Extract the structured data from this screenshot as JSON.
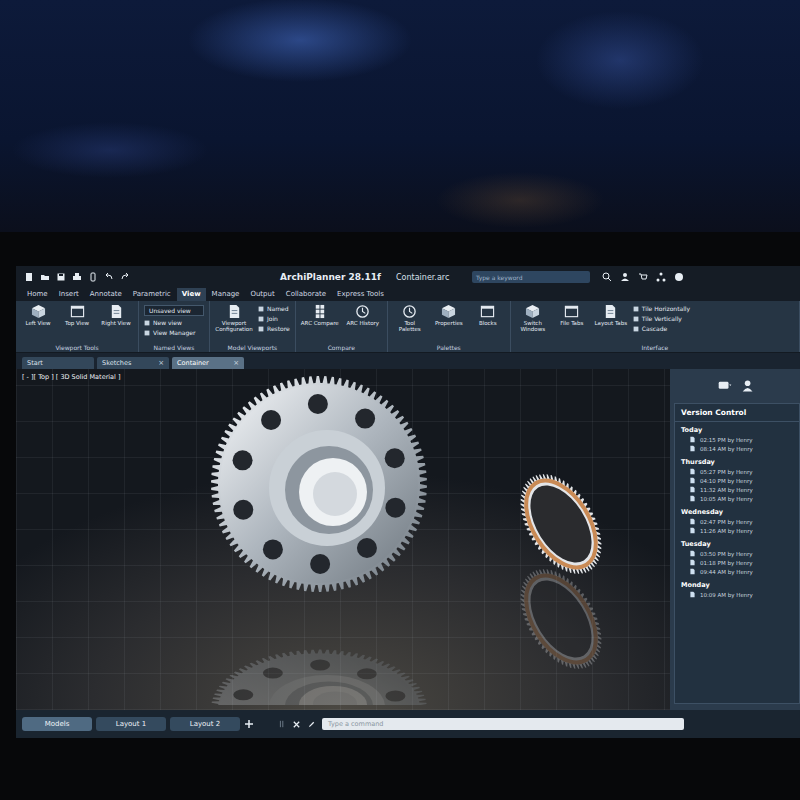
{
  "window": {
    "title": "ArchiPlanner 28.11f",
    "file": "Container.arc",
    "search": {
      "placeholder": "Type a keyword"
    }
  },
  "ribbon_tabs": [
    {
      "label": "Home",
      "selected": false
    },
    {
      "label": "Insert",
      "selected": false
    },
    {
      "label": "Annotate",
      "selected": false
    },
    {
      "label": "Parametric",
      "selected": false
    },
    {
      "label": "View",
      "selected": true
    },
    {
      "label": "Manage",
      "selected": false
    },
    {
      "label": "Output",
      "selected": false
    },
    {
      "label": "Collaborate",
      "selected": false
    },
    {
      "label": "Express Tools",
      "selected": false
    }
  ],
  "ribbon_panels": [
    {
      "title": "Viewport Tools",
      "items": [
        {
          "label": "Left View",
          "kind": "large"
        },
        {
          "label": "Top View",
          "kind": "large"
        },
        {
          "label": "Right View",
          "kind": "large"
        }
      ]
    },
    {
      "title": "Named Views",
      "items": [
        {
          "label": "Unsaved view",
          "kind": "dropdown"
        },
        {
          "label": "New view",
          "kind": "small"
        },
        {
          "label": "View Manager",
          "kind": "small"
        }
      ]
    },
    {
      "title": "Model Viewports",
      "items": [
        {
          "label": "Viewport Configuration",
          "kind": "large"
        },
        {
          "label": "Named",
          "kind": "small"
        },
        {
          "label": "Join",
          "kind": "small"
        },
        {
          "label": "Restore",
          "kind": "small"
        }
      ]
    },
    {
      "title": "Compare",
      "items": [
        {
          "label": "ARC Compare",
          "kind": "large"
        },
        {
          "label": "ARC History",
          "kind": "large"
        }
      ]
    },
    {
      "title": "Palettes",
      "items": [
        {
          "label": "Tool Palettes",
          "kind": "large"
        },
        {
          "label": "Properties",
          "kind": "large"
        },
        {
          "label": "Blocks",
          "kind": "large"
        }
      ]
    },
    {
      "title": "Interface",
      "items": [
        {
          "label": "Switch Windows",
          "kind": "large"
        },
        {
          "label": "File Tabs",
          "kind": "large"
        },
        {
          "label": "Layout Tabs",
          "kind": "large"
        },
        {
          "label": "Tile Horizontally",
          "kind": "small"
        },
        {
          "label": "Tile Vertically",
          "kind": "small"
        },
        {
          "label": "Cascade",
          "kind": "small"
        }
      ]
    }
  ],
  "doc_tabs": [
    {
      "label": "Start",
      "selected": false,
      "closable": false
    },
    {
      "label": "Sketches",
      "selected": false,
      "closable": true
    },
    {
      "label": "Container",
      "selected": true,
      "closable": true
    }
  ],
  "close_glyph": "×",
  "viewport": {
    "label": "[ - ][ Top ] [ 3D Solid Material ]"
  },
  "version_control": {
    "title": "Version Control",
    "groups": [
      {
        "day": "Today",
        "entries": [
          "02:15 PM by Henry",
          "08:14 AM by Henry"
        ]
      },
      {
        "day": "Thursday",
        "entries": [
          "05:27 PM by Henry",
          "04:10 PM by Henry",
          "11:32 AM by Henry",
          "10:05 AM by Henry"
        ]
      },
      {
        "day": "Wednesday",
        "entries": [
          "02:47 PM by Henry",
          "11:26 AM by Henry"
        ]
      },
      {
        "day": "Tuesday",
        "entries": [
          "03:50 PM by Henry",
          "01:18 PM by Henry",
          "09:44 AM by Henry"
        ]
      },
      {
        "day": "Monday",
        "entries": [
          "10:09 AM by Henry"
        ]
      }
    ]
  },
  "layout_tabs": [
    {
      "label": "Models",
      "selected": true
    },
    {
      "label": "Layout 1",
      "selected": false
    },
    {
      "label": "Layout 2",
      "selected": false
    }
  ],
  "command": {
    "placeholder": "Type a command"
  }
}
